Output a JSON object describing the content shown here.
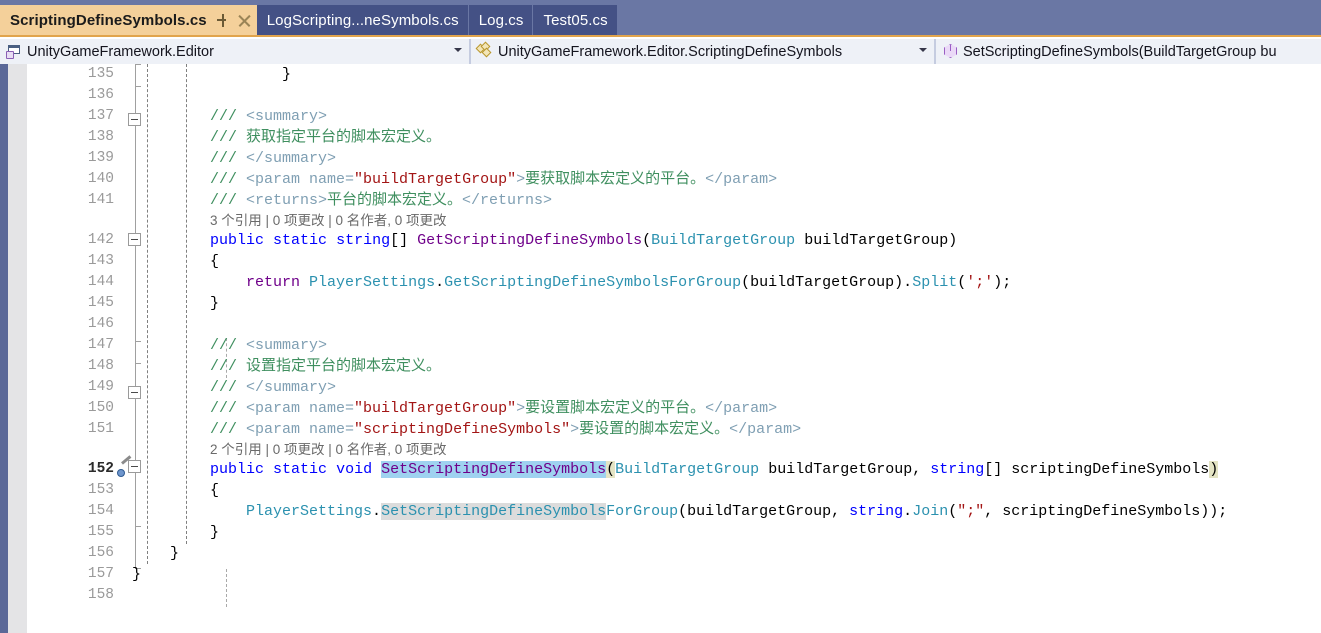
{
  "window": {
    "app": "Visual Studio Code Editor",
    "accent_orange": "#e1a44c",
    "tabstrip_bg": "#6a77a4",
    "active_tab_bg": "#f4d09a",
    "inactive_tab_bg": "#445185"
  },
  "tabs": [
    {
      "label": "ScriptingDefineSymbols.cs",
      "active": true,
      "pin_icon": "pin-icon",
      "close_icon": "close-icon"
    },
    {
      "label": "LogScripting...neSymbols.cs",
      "active": false
    },
    {
      "label": "Log.cs",
      "active": false
    },
    {
      "label": "Test05.cs",
      "active": false
    }
  ],
  "navbar": {
    "project": {
      "icon": "namespace-icon",
      "text": "UnityGameFramework.Editor",
      "dropdown_icon": "chevron-down-icon"
    },
    "type": {
      "icon": "class-icon",
      "text": "UnityGameFramework.Editor.ScriptingDefineSymbols",
      "dropdown_icon": "chevron-down-icon"
    },
    "member": {
      "icon": "method-icon",
      "text": "SetScriptingDefineSymbols(BuildTargetGroup bu"
    }
  },
  "editor": {
    "current_line": 152,
    "quick_action_icon": "wrench-icon",
    "lines": [
      {
        "n": "135"
      },
      {
        "n": "136"
      },
      {
        "n": "137"
      },
      {
        "n": "138"
      },
      {
        "n": "139"
      },
      {
        "n": "140"
      },
      {
        "n": "141"
      },
      {
        "n": "142"
      },
      {
        "n": "143"
      },
      {
        "n": "144"
      },
      {
        "n": "145"
      },
      {
        "n": "146"
      },
      {
        "n": "147"
      },
      {
        "n": "148"
      },
      {
        "n": "149"
      },
      {
        "n": "150"
      },
      {
        "n": "151"
      },
      {
        "n": "152"
      },
      {
        "n": "153"
      },
      {
        "n": "154"
      },
      {
        "n": "155"
      },
      {
        "n": "156"
      },
      {
        "n": "157"
      },
      {
        "n": "158"
      }
    ],
    "codelens": [
      {
        "after_line": "141",
        "text": "3 个引用 | 0 项更改 | 0 名作者, 0 项更改"
      },
      {
        "after_line": "151",
        "text": "2 个引用 | 0 项更改 | 0 名作者, 0 项更改"
      }
    ],
    "code": {
      "l135": "}",
      "l137": "/// <summary>",
      "l138": "/// 获取指定平台的脚本宏定义。",
      "l139": "/// </summary>",
      "l140": "/// <param name=\"buildTargetGroup\">要获取脚本宏定义的平台。</param>",
      "l141": "/// <returns>平台的脚本宏定义。</returns>",
      "l142": "public static string[] GetScriptingDefineSymbols(BuildTargetGroup buildTargetGroup)",
      "l143": "{",
      "l144": "return PlayerSettings.GetScriptingDefineSymbolsForGroup(buildTargetGroup).Split(';');",
      "l145": "}",
      "l147": "/// <summary>",
      "l148": "/// 设置指定平台的脚本宏定义。",
      "l149": "/// </summary>",
      "l150": "/// <param name=\"buildTargetGroup\">要设置脚本宏定义的平台。</param>",
      "l151": "/// <param name=\"scriptingDefineSymbols\">要设置的脚本宏定义。</param>",
      "l152": "public static void SetScriptingDefineSymbols(BuildTargetGroup buildTargetGroup, string[] scriptingDefineSymbols)",
      "l153": "{",
      "l154": "PlayerSettings.SetScriptingDefineSymbolsForGroup(buildTargetGroup, string.Join(\";\", scriptingDefineSymbols));",
      "l155": "}",
      "l156": "}",
      "l157": "}"
    },
    "selection": {
      "text": "SetScriptingDefineSymbols",
      "line": "152",
      "color": "#9fd2f0"
    },
    "reference_highlight": {
      "text": "SetScriptingDefineSymbols",
      "line": "154",
      "color": "#dcdcdc"
    }
  }
}
